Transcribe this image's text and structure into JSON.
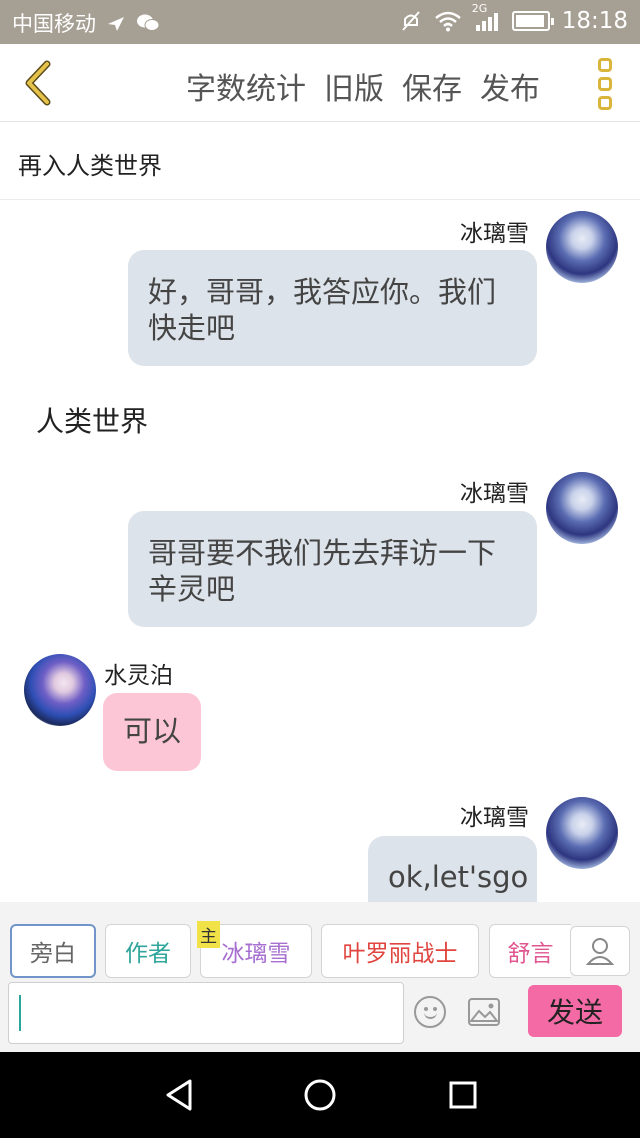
{
  "status_bar": {
    "carrier": "中国移动",
    "network": "2G",
    "time": "18:18"
  },
  "toolbar": {
    "word_count_label": "字数统计",
    "old_version_label": "旧版",
    "save_label": "保存",
    "publish_label": "发布"
  },
  "chapter": {
    "title": "再入人类世界"
  },
  "messages": [
    {
      "name": "冰璃雪",
      "text": "好，哥哥，我答应你。我们快走吧"
    },
    {
      "narration": "人类世界"
    },
    {
      "name": "冰璃雪",
      "text": "哥哥要不我们先去拜访一下辛灵吧"
    },
    {
      "name": "水灵泊",
      "text": "可以"
    },
    {
      "name": "冰璃雪",
      "text": "ok,let'sgo"
    }
  ],
  "roles": [
    {
      "label": "旁白",
      "color": "#666666"
    },
    {
      "label": "作者",
      "color": "#2fa59b"
    },
    {
      "label": "冰璃雪",
      "color": "#a76fd0",
      "tag": "主"
    },
    {
      "label": "叶罗丽战士",
      "color": "#e0453f"
    },
    {
      "label": "舒言",
      "color": "#e05691"
    }
  ],
  "composer": {
    "input_value": "",
    "send_label": "发送"
  },
  "colors": {
    "status_bar": "#a69f93",
    "accent_gold": "#d9b53c",
    "bubble_right": "#dde3ea",
    "bubble_left": "#fcc6d6",
    "send_button": "#f46aa5"
  }
}
